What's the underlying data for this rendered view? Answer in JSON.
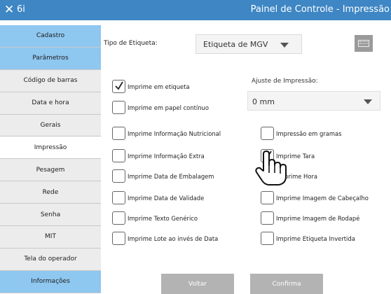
{
  "titlebar": {
    "close_glyph": "✕",
    "app_name": "6i",
    "title": "Painel de Controle - Impressão"
  },
  "sidebar": {
    "items": [
      {
        "label": "Cadastro",
        "style": "blue"
      },
      {
        "label": "Parâmetros",
        "style": "blue"
      },
      {
        "label": "Código de barras",
        "style": "gray"
      },
      {
        "label": "Data e hora",
        "style": "gray"
      },
      {
        "label": "Gerais",
        "style": "gray"
      },
      {
        "label": "Impressão",
        "style": "active"
      },
      {
        "label": "Pesagem",
        "style": "gray"
      },
      {
        "label": "Rede",
        "style": "gray"
      },
      {
        "label": "Senha",
        "style": "gray"
      },
      {
        "label": "MIT",
        "style": "gray"
      },
      {
        "label": "Tela do operador",
        "style": "gray"
      },
      {
        "label": "Informações",
        "style": "blue"
      }
    ]
  },
  "form": {
    "tipo_label": "Tipo de Etiqueta:",
    "tipo_value": "Etiqueta de MGV",
    "keyboard_icon": "keyboard-icon",
    "ajuste_label": "Ajuste de Impressão:",
    "ajuste_value": "0 mm"
  },
  "options": {
    "imprime_etiqueta": {
      "label": "Imprime em etiqueta",
      "checked": true
    },
    "papel_continuo": {
      "label": "Imprime em papel contínuo",
      "checked": false
    },
    "left": [
      {
        "label": "Imprime Informação Nutricional",
        "checked": false
      },
      {
        "label": "Imprime Informação Extra",
        "checked": false
      },
      {
        "label": "Imprime Data de Embalagem",
        "checked": false
      },
      {
        "label": "Imprime Data de Validade",
        "checked": false
      },
      {
        "label": "Imprime Texto Genérico",
        "checked": false
      },
      {
        "label": "Imprime Lote ao invés de Data",
        "checked": false
      }
    ],
    "right": [
      {
        "label": "Impressão em gramas",
        "checked": false
      },
      {
        "label": "Imprime Tara",
        "checked": true
      },
      {
        "label": "Imprime Hora",
        "checked": false,
        "partial_visible": "prime Hora"
      },
      {
        "label": "Imprime Imagem de Cabeçalho",
        "checked": false
      },
      {
        "label": "Imprime Imagem de Rodapé",
        "checked": false
      },
      {
        "label": "Imprime Etiqueta Invertida",
        "checked": false
      }
    ]
  },
  "buttons": {
    "voltar": "Voltar",
    "confirma": "Confirma"
  },
  "colors": {
    "titlebar": "#3e86c4",
    "sidebar_blue": "#8ec7f0",
    "sidebar_gray": "#ececec",
    "button": "#b3b3b3"
  }
}
